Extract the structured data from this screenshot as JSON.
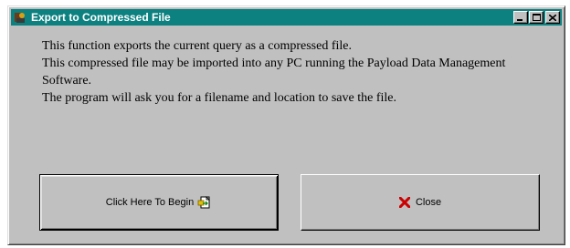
{
  "window": {
    "title": "Export to Compressed File",
    "title_icon": "app-icon",
    "title_buttons": [
      "minimize",
      "maximize",
      "close"
    ]
  },
  "message": {
    "lines": [
      "This function exports the current query as a compressed file.",
      "This compressed file may be imported into any PC running the Payload Data Management Software.",
      "The program will ask you for a filename and location to save the file."
    ]
  },
  "buttons": {
    "begin": {
      "label": "Click Here To Begin",
      "icon": "export-file-icon"
    },
    "close": {
      "label": "Close",
      "icon": "red-x-icon"
    }
  },
  "colors": {
    "titlebar": "#0d8080",
    "face": "#c0c0c0",
    "close_icon": "#cc0000"
  }
}
